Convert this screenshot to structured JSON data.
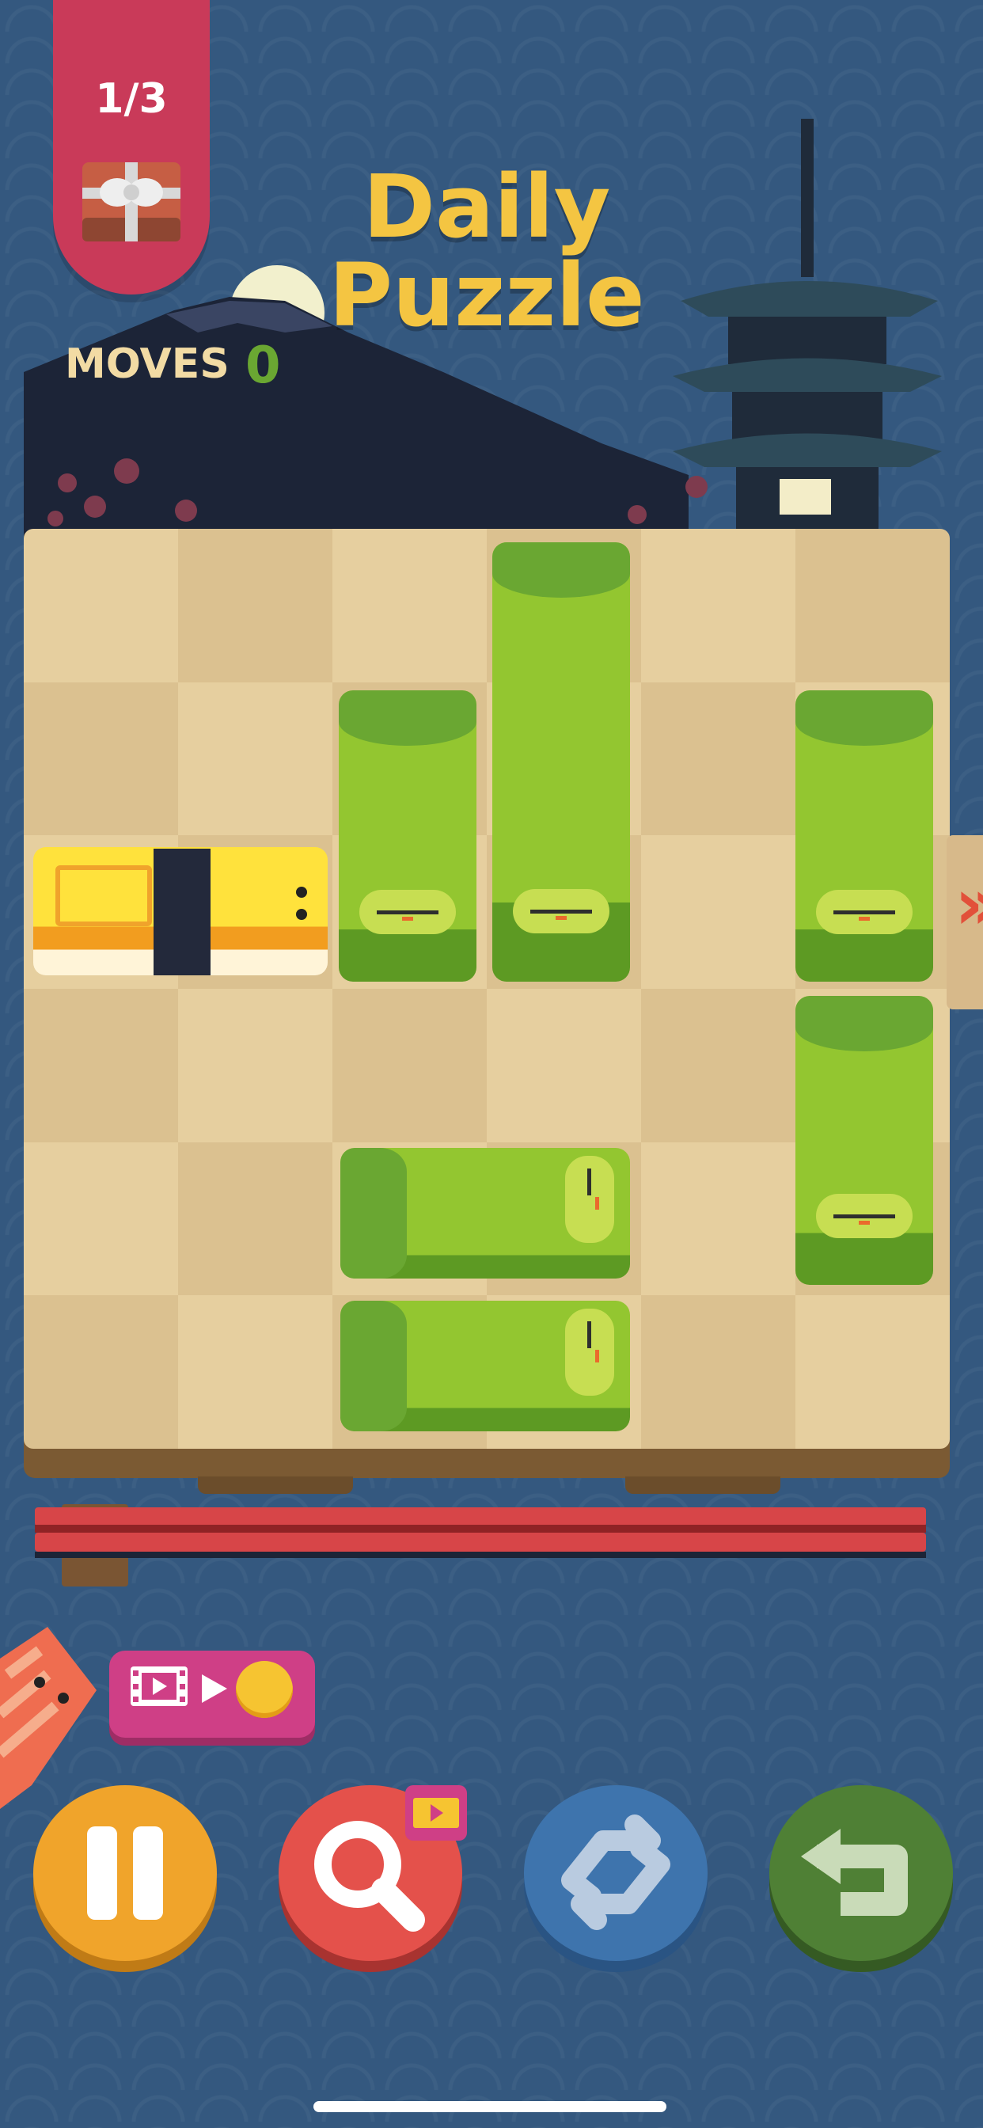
{
  "header": {
    "progress_label": "1/3",
    "title_line1": "Daily",
    "title_line2": "Puzzle",
    "moves_label": "MOVES",
    "moves_value": "0"
  },
  "board": {
    "columns": 6,
    "rows": 6,
    "exit_row": 3,
    "pieces": [
      {
        "name": "tamago-piece",
        "type": "tamago",
        "orientation": "horizontal",
        "col": 1,
        "row": 3,
        "length": 2
      },
      {
        "name": "wasabi-vertical-1",
        "type": "wasabi",
        "orientation": "vertical",
        "col": 3,
        "row": 2,
        "length": 2
      },
      {
        "name": "wasabi-vertical-2",
        "type": "wasabi",
        "orientation": "vertical",
        "col": 4,
        "row": 1,
        "length": 3
      },
      {
        "name": "wasabi-vertical-3",
        "type": "wasabi",
        "orientation": "vertical",
        "col": 6,
        "row": 2,
        "length": 2
      },
      {
        "name": "wasabi-vertical-4",
        "type": "wasabi",
        "orientation": "vertical",
        "col": 6,
        "row": 4,
        "length": 2
      },
      {
        "name": "wasabi-horizontal-1",
        "type": "wasabi",
        "orientation": "horizontal",
        "col": 3,
        "row": 5,
        "length": 2
      },
      {
        "name": "wasabi-horizontal-2",
        "type": "wasabi",
        "orientation": "horizontal",
        "col": 3,
        "row": 6,
        "length": 2
      }
    ]
  },
  "controls": {
    "ad_reward": {
      "icons": [
        "film-icon",
        "play-icon",
        "coin-icon"
      ]
    },
    "buttons": [
      {
        "name": "pause-button",
        "icon": "pause-icon",
        "color": "#f0a42b"
      },
      {
        "name": "hint-button",
        "icon": "magnifier-icon",
        "color": "#e4514b",
        "badge_icon": "film-icon"
      },
      {
        "name": "restart-button",
        "icon": "refresh-arrows-icon",
        "color": "#3e74ad"
      },
      {
        "name": "undo-button",
        "icon": "undo-arrow-icon",
        "color": "#4f8035"
      }
    ]
  },
  "colors": {
    "background": "#34587f",
    "title": "#f4c542",
    "ribbon": "#c93a59",
    "moves_value": "#6aa732",
    "board_light": "#e6cf9f",
    "board_dark": "#dbc190"
  }
}
